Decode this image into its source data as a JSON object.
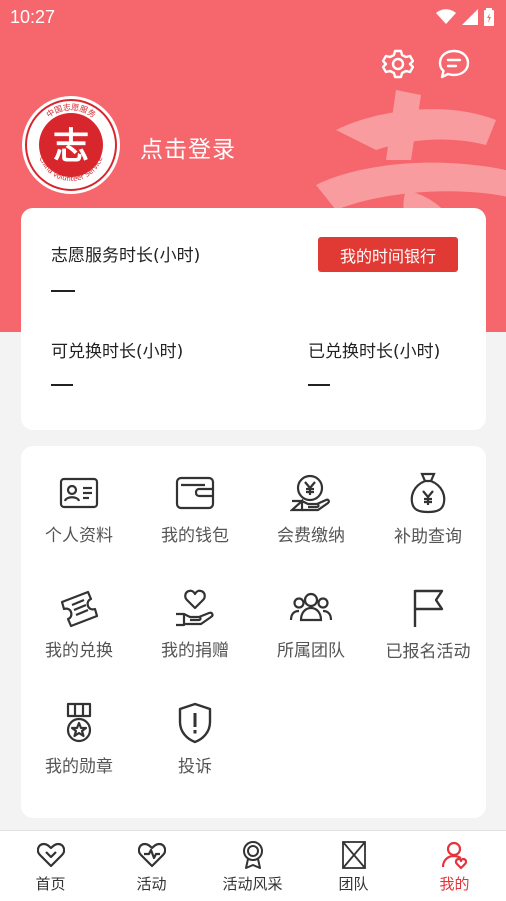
{
  "status": {
    "time": "10:27"
  },
  "profile": {
    "login_text": "点击登录",
    "logo_inner_text": "志",
    "logo_ring_top": "中国志愿服务",
    "logo_ring_bottom": "China Volunteer Service"
  },
  "stats": {
    "service_hours_label": "志愿服务时长(小时)",
    "service_hours_value": "—",
    "bank_button": "我的时间银行",
    "exchangeable_label": "可兑换时长(小时)",
    "exchangeable_value": "—",
    "exchanged_label": "已兑换时长(小时)",
    "exchanged_value": "—"
  },
  "grid": [
    {
      "label": "个人资料",
      "icon": "id-card-icon"
    },
    {
      "label": "我的钱包",
      "icon": "wallet-icon"
    },
    {
      "label": "会费缴纳",
      "icon": "fee-payment-icon"
    },
    {
      "label": "补助查询",
      "icon": "money-bag-icon"
    },
    {
      "label": "我的兑换",
      "icon": "ticket-icon"
    },
    {
      "label": "我的捐赠",
      "icon": "heart-hand-icon"
    },
    {
      "label": "所属团队",
      "icon": "team-icon"
    },
    {
      "label": "已报名活动",
      "icon": "flag-icon"
    },
    {
      "label": "我的勋章",
      "icon": "medal-icon"
    },
    {
      "label": "投诉",
      "icon": "shield-alert-icon"
    }
  ],
  "nav": [
    {
      "label": "首页",
      "icon": "heart-home-icon",
      "active": false
    },
    {
      "label": "活动",
      "icon": "heart-activity-icon",
      "active": false
    },
    {
      "label": "活动风采",
      "icon": "award-icon",
      "active": false
    },
    {
      "label": "团队",
      "icon": "team-box-icon",
      "active": false
    },
    {
      "label": "我的",
      "icon": "user-icon",
      "active": true
    }
  ],
  "colors": {
    "header": "#f5676d",
    "accent": "#e13a35",
    "active_nav": "#e8323a"
  }
}
